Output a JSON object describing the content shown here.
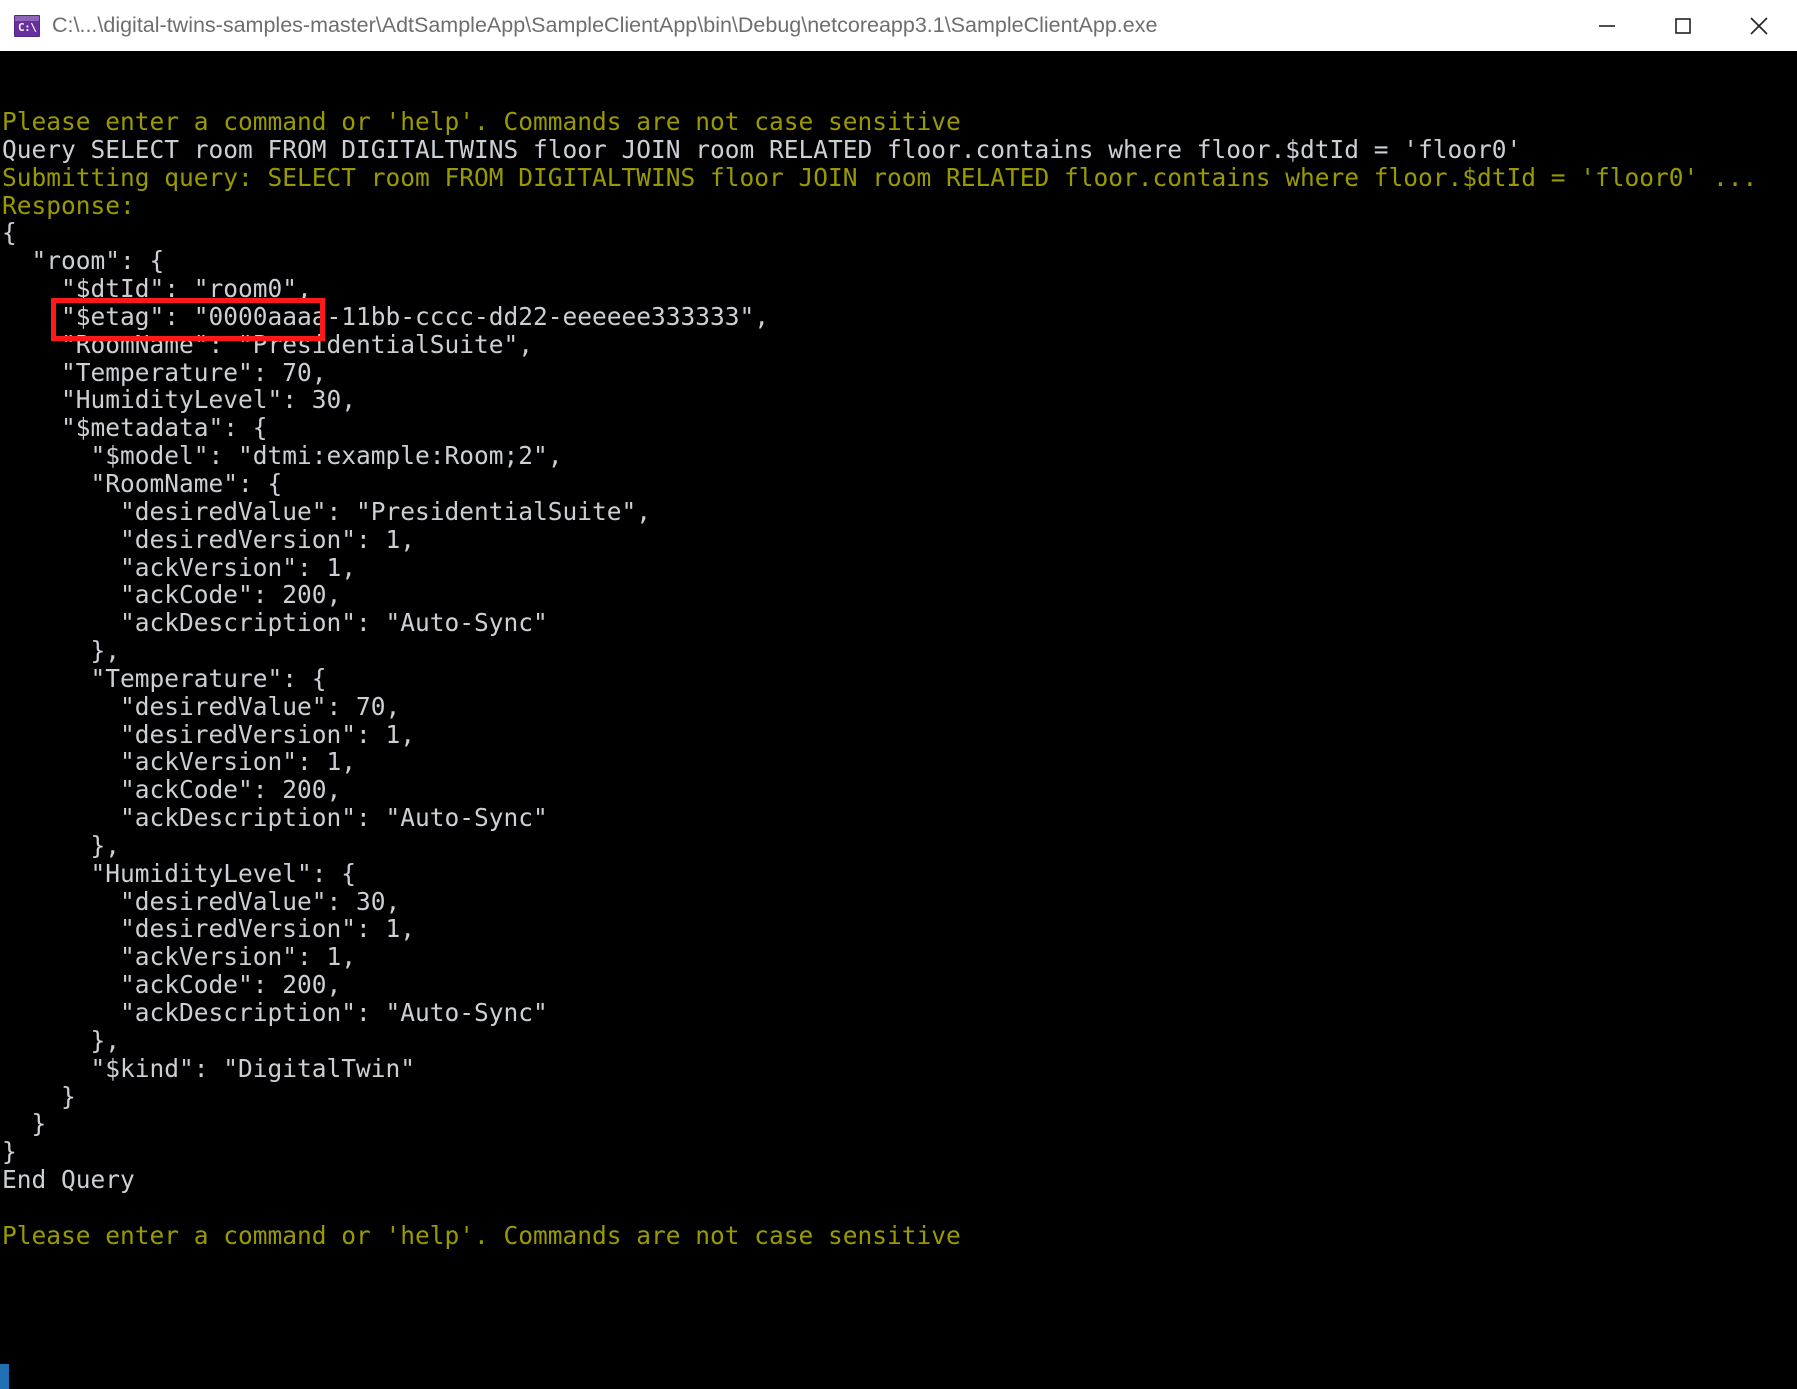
{
  "window": {
    "title": "C:\\...\\digital-twins-samples-master\\AdtSampleApp\\SampleClientApp\\bin\\Debug\\netcoreapp3.1\\SampleClientApp.exe",
    "icon": "console-app-icon",
    "icon_glyph": "C:\\",
    "buttons": {
      "minimize": "minimize-button",
      "maximize": "maximize-button",
      "close": "close-button"
    },
    "titlebar_bg": "#ffffff",
    "title_color": "#6e6e6e"
  },
  "console": {
    "background": "#000000",
    "default_text_color": "#ccd0d4",
    "highlight_text_color": "#9a9a00",
    "annotation": {
      "type": "rectangle",
      "color": "#ff1a1a",
      "target_text": "\"$dtId\": \"room0\","
    },
    "cursor_color": "#1f6fb5",
    "lines": [
      {
        "text": "Please enter a command or 'help'. Commands are not case sensitive",
        "color": "yellow"
      },
      {
        "text": "Query SELECT room FROM DIGITALTWINS floor JOIN room RELATED floor.contains where floor.$dtId = 'floor0'",
        "color": "white"
      },
      {
        "text": "Submitting query: SELECT room FROM DIGITALTWINS floor JOIN room RELATED floor.contains where floor.$dtId = 'floor0' ...",
        "color": "yellow"
      },
      {
        "text": "Response:",
        "color": "yellow"
      },
      {
        "text": "{",
        "color": "white"
      },
      {
        "text": "  \"room\": {",
        "color": "white"
      },
      {
        "text": "    \"$dtId\": \"room0\",",
        "color": "white"
      },
      {
        "text": "    \"$etag\": \"0000aaaa-11bb-cccc-dd22-eeeeee333333\",",
        "color": "white"
      },
      {
        "text": "    \"RoomName\": \"PresidentialSuite\",",
        "color": "white"
      },
      {
        "text": "    \"Temperature\": 70,",
        "color": "white"
      },
      {
        "text": "    \"HumidityLevel\": 30,",
        "color": "white"
      },
      {
        "text": "    \"$metadata\": {",
        "color": "white"
      },
      {
        "text": "      \"$model\": \"dtmi:example:Room;2\",",
        "color": "white"
      },
      {
        "text": "      \"RoomName\": {",
        "color": "white"
      },
      {
        "text": "        \"desiredValue\": \"PresidentialSuite\",",
        "color": "white"
      },
      {
        "text": "        \"desiredVersion\": 1,",
        "color": "white"
      },
      {
        "text": "        \"ackVersion\": 1,",
        "color": "white"
      },
      {
        "text": "        \"ackCode\": 200,",
        "color": "white"
      },
      {
        "text": "        \"ackDescription\": \"Auto-Sync\"",
        "color": "white"
      },
      {
        "text": "      },",
        "color": "white"
      },
      {
        "text": "      \"Temperature\": {",
        "color": "white"
      },
      {
        "text": "        \"desiredValue\": 70,",
        "color": "white"
      },
      {
        "text": "        \"desiredVersion\": 1,",
        "color": "white"
      },
      {
        "text": "        \"ackVersion\": 1,",
        "color": "white"
      },
      {
        "text": "        \"ackCode\": 200,",
        "color": "white"
      },
      {
        "text": "        \"ackDescription\": \"Auto-Sync\"",
        "color": "white"
      },
      {
        "text": "      },",
        "color": "white"
      },
      {
        "text": "      \"HumidityLevel\": {",
        "color": "white"
      },
      {
        "text": "        \"desiredValue\": 30,",
        "color": "white"
      },
      {
        "text": "        \"desiredVersion\": 1,",
        "color": "white"
      },
      {
        "text": "        \"ackVersion\": 1,",
        "color": "white"
      },
      {
        "text": "        \"ackCode\": 200,",
        "color": "white"
      },
      {
        "text": "        \"ackDescription\": \"Auto-Sync\"",
        "color": "white"
      },
      {
        "text": "      },",
        "color": "white"
      },
      {
        "text": "      \"$kind\": \"DigitalTwin\"",
        "color": "white"
      },
      {
        "text": "    }",
        "color": "white"
      },
      {
        "text": "  }",
        "color": "white"
      },
      {
        "text": "}",
        "color": "white"
      },
      {
        "text": "End Query",
        "color": "white"
      },
      {
        "text": "",
        "color": "white"
      },
      {
        "text": "Please enter a command or 'help'. Commands are not case sensitive",
        "color": "yellow"
      }
    ]
  }
}
